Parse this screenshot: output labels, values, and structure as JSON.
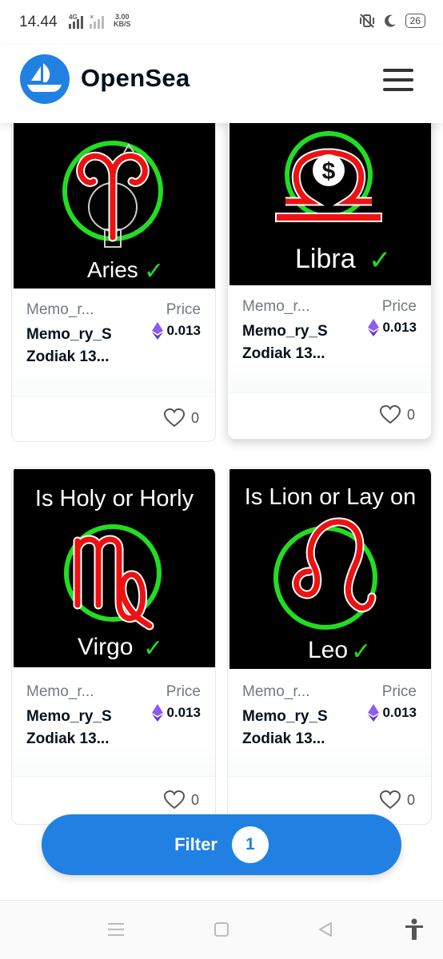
{
  "status_bar": {
    "time": "14.44",
    "network": "4G",
    "speed_value": "3.00",
    "speed_unit": "KB/S",
    "battery": "26"
  },
  "header": {
    "brand": "OpenSea",
    "logo_icon": "sailboat-logo-icon",
    "menu_icon": "hamburger-menu-icon"
  },
  "cards": [
    {
      "art_sign": "Aries",
      "art_top_text": "",
      "collection": "Memo_r...",
      "price_label": "Price",
      "price_value": "0.013",
      "name": "Memo_ry_S Zodiak 13...",
      "likes": "0"
    },
    {
      "art_sign": "Libra",
      "art_top_text": "",
      "collection": "Memo_r...",
      "price_label": "Price",
      "price_value": "0.013",
      "name": "Memo_ry_S Zodiak 13...",
      "likes": "0"
    },
    {
      "art_sign": "Virgo",
      "art_top_text": "Is Holy or Horly",
      "collection": "Memo_r...",
      "price_label": "Price",
      "price_value": "0.013",
      "name": "Memo_ry_S Zodiak 13...",
      "likes": "0"
    },
    {
      "art_sign": "Leo",
      "art_top_text": "Is Lion or Lay on",
      "collection": "Memo_r...",
      "price_label": "Price",
      "price_value": "0.013",
      "name": "Memo_ry_S Zodiak 13...",
      "likes": "0"
    }
  ],
  "check_mark": "✓",
  "filter": {
    "label": "Filter",
    "count": "1"
  },
  "colors": {
    "brand_blue": "#2081e2",
    "eth_purple": "#8a5cf6",
    "art_green": "#22dd22",
    "art_red": "#ee1111"
  }
}
